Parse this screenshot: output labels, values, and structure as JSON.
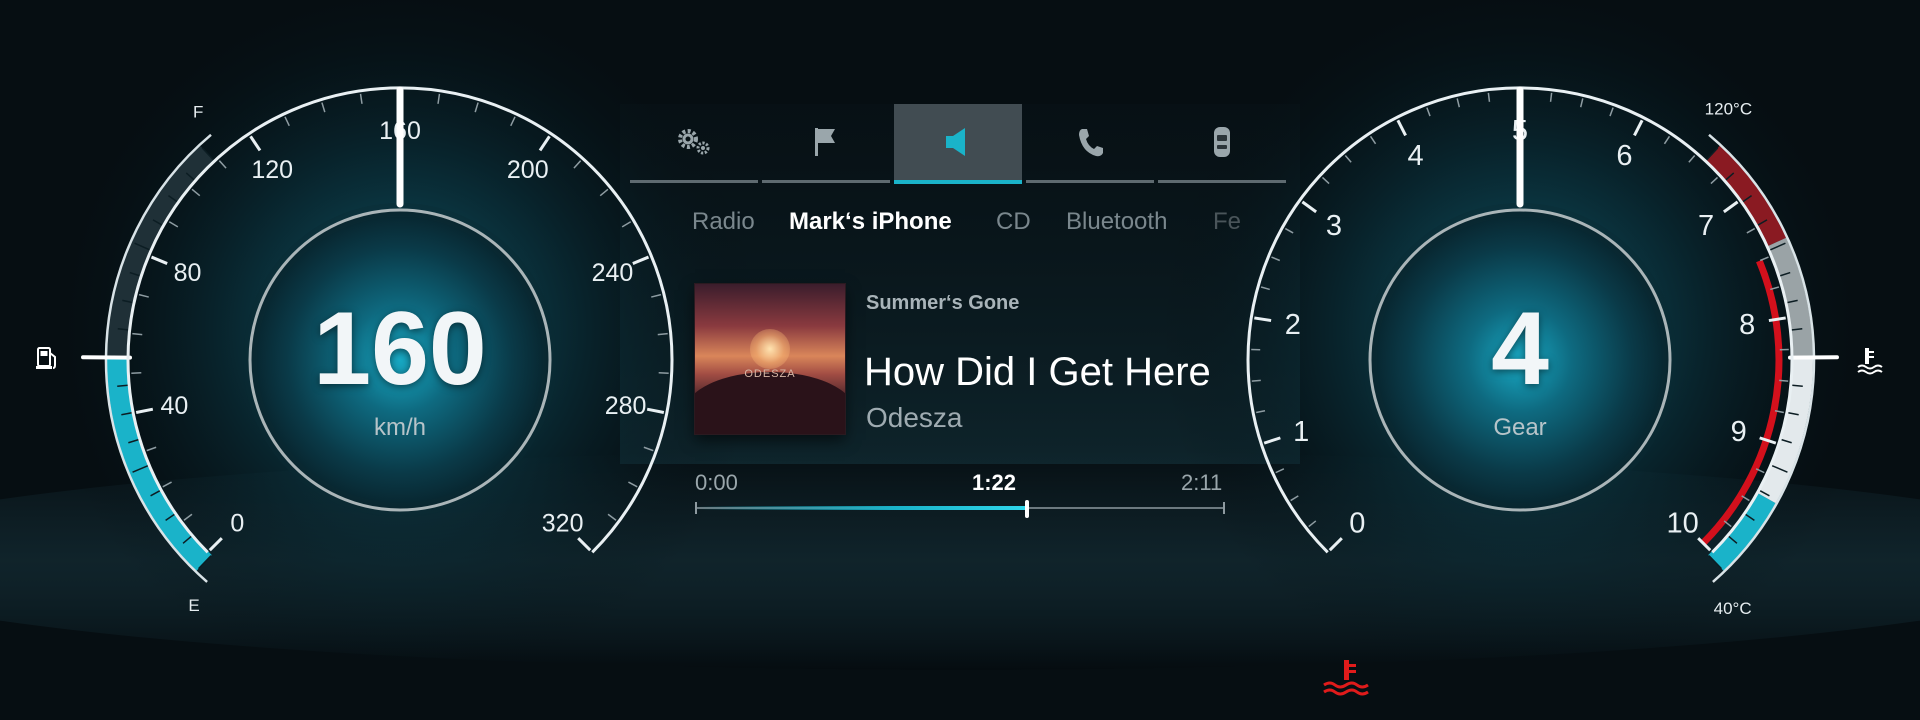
{
  "colors": {
    "accent": "#1ab3c9",
    "warning": "#e01b1b",
    "hot_zone": "#8a1a22",
    "text": "#ffffff",
    "dim_text": "#7a878d"
  },
  "speedometer": {
    "value": "160",
    "unit": "km/h",
    "needle_value": 160,
    "ticks": [
      "0",
      "40",
      "80",
      "120",
      "160",
      "200",
      "240",
      "280",
      "320"
    ],
    "min": 0,
    "max": 320
  },
  "fuel_gauge": {
    "full_label": "F",
    "empty_label": "E",
    "level": 0.5,
    "icon": "fuel-pump-icon"
  },
  "gear_gauge": {
    "value": "4",
    "label": "Gear",
    "needle_value": 5,
    "ticks": [
      "0",
      "1",
      "2",
      "3",
      "4",
      "5",
      "6",
      "7",
      "8",
      "9",
      "10"
    ],
    "redline_from": 7.5
  },
  "temp_gauge": {
    "hot_label": "120°C",
    "cold_label": "40°C",
    "icon": "coolant-temperature-icon",
    "level": 0.5
  },
  "tabs": [
    {
      "icon": "settings-gears-icon",
      "active": false
    },
    {
      "icon": "navigation-flag-icon",
      "active": false
    },
    {
      "icon": "speaker-icon",
      "active": true
    },
    {
      "icon": "phone-icon",
      "active": false
    },
    {
      "icon": "car-icon",
      "active": false
    }
  ],
  "sources": {
    "radio": "Radio",
    "phone": "Mark‘s iPhone",
    "cd": "CD",
    "bluetooth": "Bluetooth",
    "fav": "Fe"
  },
  "track": {
    "album": "Summer‘s Gone",
    "title": "How Did I Get Here",
    "artist": "Odesza",
    "cover_text": "ODESZA"
  },
  "playback": {
    "start": "0:00",
    "current": "1:22",
    "end": "2:11",
    "progress": 0.626
  },
  "warning": {
    "icon": "coolant-temperature-warning-icon"
  }
}
